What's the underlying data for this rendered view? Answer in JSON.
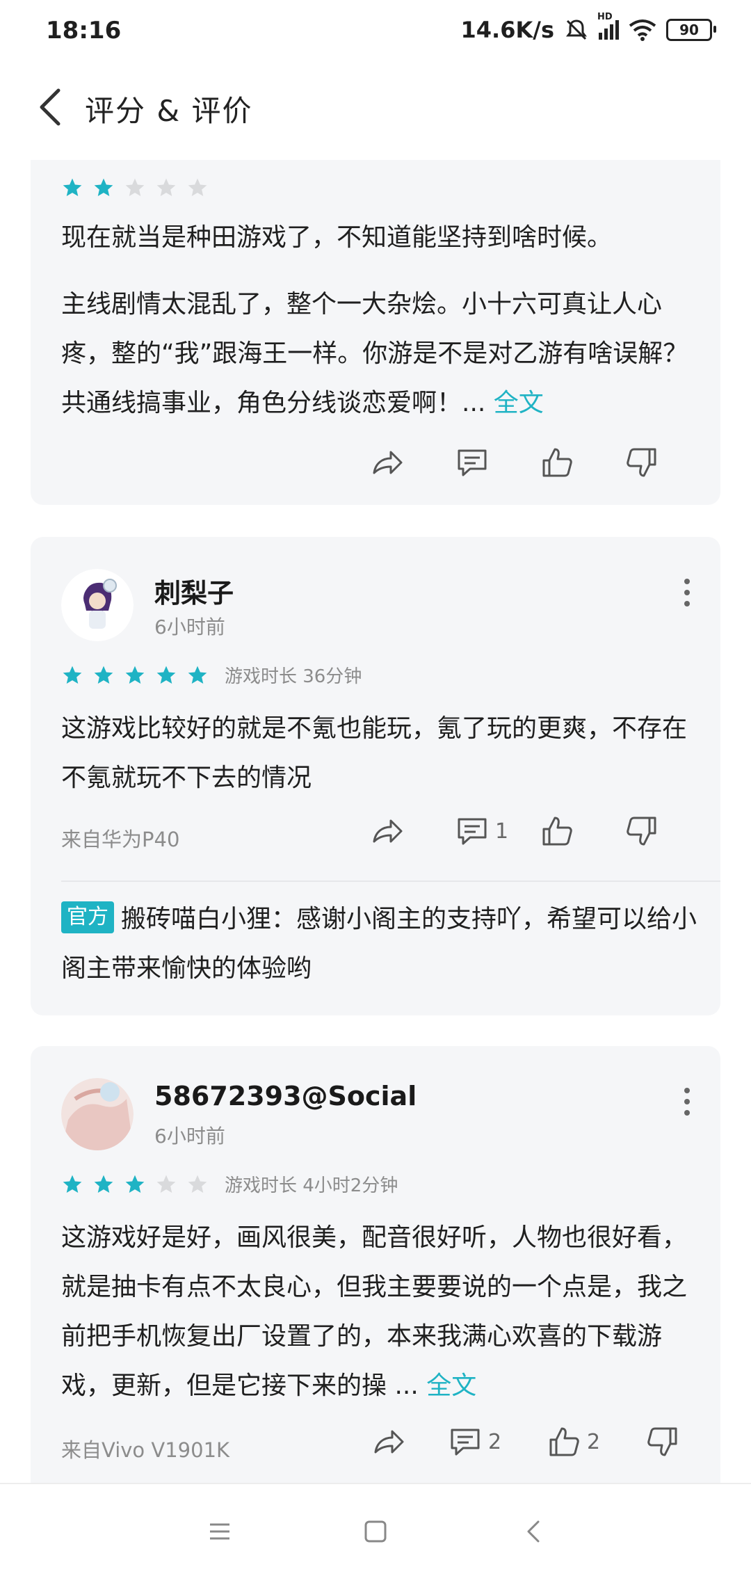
{
  "status_bar": {
    "time": "18:16",
    "net_speed": "14.6K/s",
    "signal_label": "HD",
    "battery": "90"
  },
  "header": {
    "title": "评分 & 评价"
  },
  "reviews": [
    {
      "rating": 2,
      "text1": "现在就当是种田游戏了，不知道能坚持到啥时候。",
      "text2": "主线剧情太混乱了，整个一大杂烩。小十六可真让人心疼，整的“我”跟海王一样。你游是不是对乙游有啥误解？共通线搞事业，角色分线谈恋爱啊！...",
      "full_label": "全文"
    },
    {
      "username": "刺梨子",
      "time": "6小时前",
      "rating": 5,
      "duration": "游戏时长 36分钟",
      "text": "这游戏比较好的就是不氪也能玩，氪了玩的更爽，不存在不氪就玩不下去的情况",
      "device": "来自华为P40",
      "comment_count": "1",
      "official_tag": "官方",
      "official_reply": "搬砖喵白小狸：感谢小阁主的支持吖，希望可以给小阁主带来愉快的体验哟"
    },
    {
      "username": "58672393@Social",
      "time": "6小时前",
      "rating": 3,
      "duration": "游戏时长 4小时2分钟",
      "text": "这游戏好是好，画风很美，配音很好听，人物也很好看，就是抽卡有点不太良心，但我主要要说的一个点是，我之前把手机恢复出厂设置了的，本来我满心欢喜的下载游戏，更新，但是它接下来的操 ...",
      "full_label": "全文",
      "device": "来自Vivo V1901K",
      "comment_count": "2",
      "like_count": "2"
    }
  ],
  "colors": {
    "accent": "#1fb3c4",
    "star_empty": "#d9dadc",
    "card_bg": "#f5f6f8"
  },
  "icons": [
    "back-icon",
    "star-icon",
    "share-icon",
    "comment-icon",
    "like-icon",
    "dislike-icon",
    "more-icon",
    "menu-icon",
    "home-icon",
    "nav-back-icon"
  ]
}
